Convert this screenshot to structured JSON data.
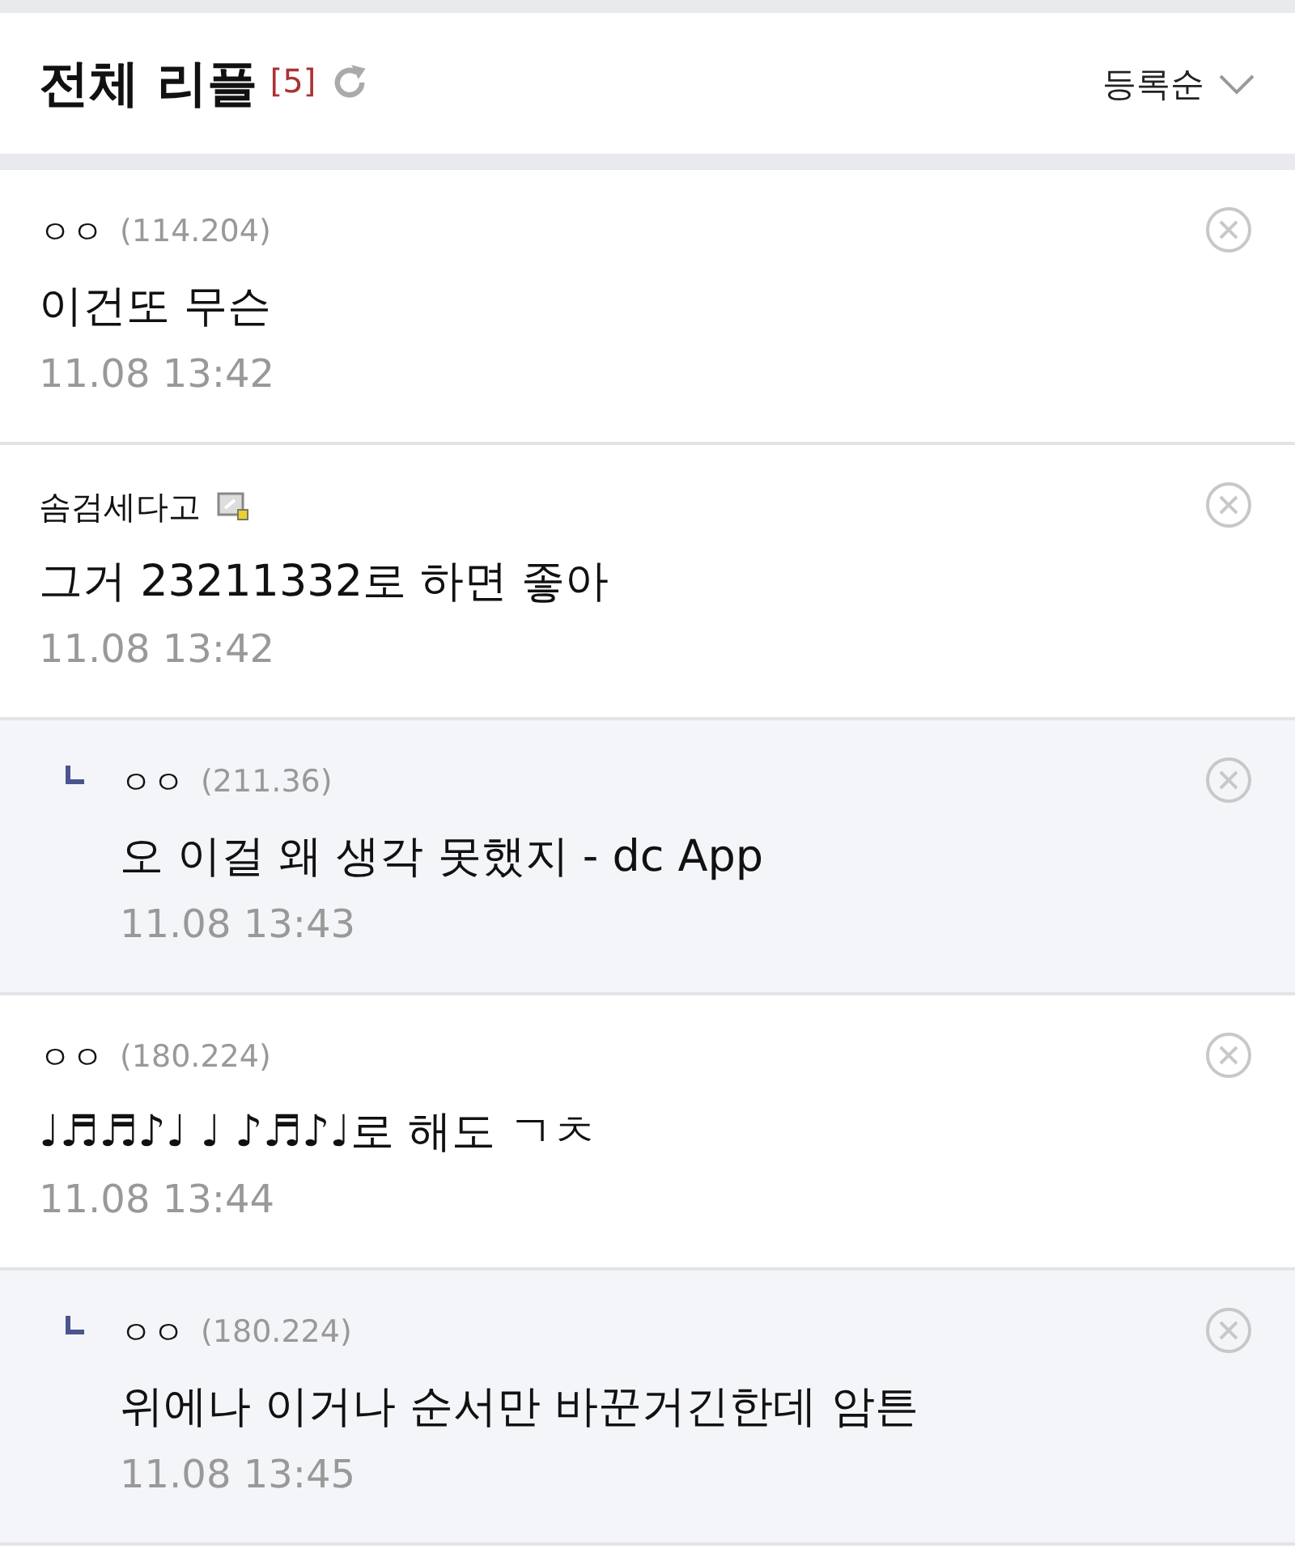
{
  "header": {
    "title": "전체 리플",
    "count": "[5]",
    "sort": "등록순"
  },
  "comments": [
    {
      "kind": "comment",
      "author": "ㅇㅇ",
      "ip": "(114.204)",
      "member_badge": false,
      "text": "이건또 무슨",
      "date": "11.08 13:42"
    },
    {
      "kind": "comment",
      "author": "솜검세다고",
      "member_badge": true,
      "text": "그거 23211332로 하면 좋아",
      "date": "11.08 13:42"
    },
    {
      "kind": "reply",
      "author": "ㅇㅇ",
      "ip": "(211.36)",
      "member_badge": false,
      "text": "오 이걸 왜 생각 못했지 - dc App",
      "date": "11.08 13:43"
    },
    {
      "kind": "comment",
      "author": "ㅇㅇ",
      "ip": "(180.224)",
      "member_badge": false,
      "text": "♩♬♬♪♩ ♩ ♪♬♪♩로 해도 ㄱㅊ",
      "date": "11.08 13:44"
    },
    {
      "kind": "reply",
      "author": "ㅇㅇ",
      "ip": "(180.224)",
      "member_badge": false,
      "text": "위에나 이거나 순서만 바꾼거긴한데 암튼",
      "date": "11.08 13:45"
    }
  ]
}
